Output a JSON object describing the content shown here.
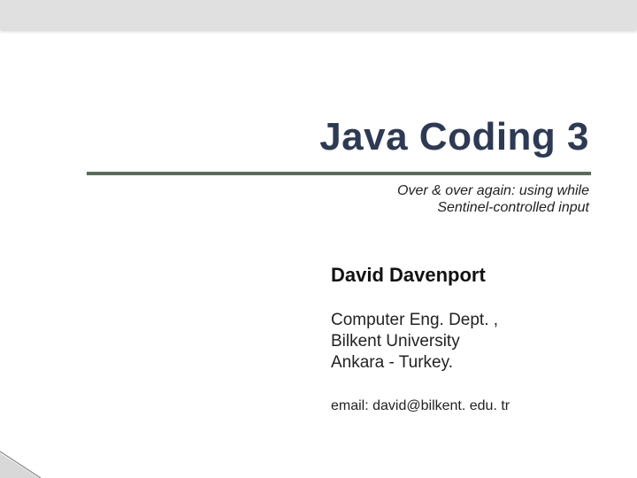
{
  "title": "Java Coding 3",
  "subtitle_line1": "Over & over again: using while",
  "subtitle_line2": "Sentinel-controlled input",
  "author": "David Davenport",
  "affiliation_line1": "Computer Eng. Dept. ,",
  "affiliation_line2": "Bilkent University",
  "affiliation_line3": "Ankara - Turkey.",
  "email": "email: david@bilkent. edu. tr"
}
